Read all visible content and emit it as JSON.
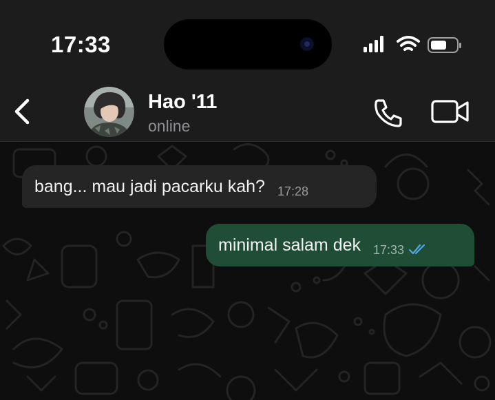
{
  "status_bar": {
    "time": "17:33",
    "icons": [
      "cellular-signal-icon",
      "wifi-icon",
      "battery-icon"
    ]
  },
  "nav": {
    "back_icon": "chevron-left-icon",
    "contact_name": "Hao '11",
    "contact_status": "online",
    "actions": [
      "phone-icon",
      "video-camera-icon"
    ]
  },
  "messages": [
    {
      "direction": "incoming",
      "text": "bang... mau jadi pacarku kah?",
      "time": "17:28"
    },
    {
      "direction": "outgoing",
      "text": "minimal salam dek",
      "time": "17:33",
      "status": "read"
    }
  ],
  "colors": {
    "header_bg": "#1c1c1d",
    "incoming_bubble": "#252525",
    "outgoing_bubble": "#1f4d36",
    "read_tick": "#53a8e8",
    "secondary_text": "#8e8e93"
  }
}
